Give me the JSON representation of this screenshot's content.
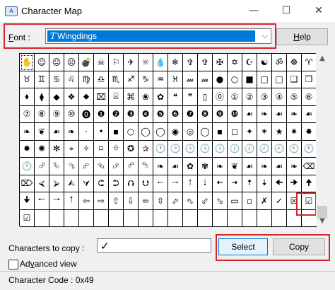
{
  "window": {
    "title": "Character Map",
    "app_icon_text": "A",
    "minimize": "—",
    "maximize": "☐",
    "close": "✕"
  },
  "font": {
    "label_prefix": "F",
    "label_rest": "ont :",
    "icon": "T",
    "selected": "Wingdings",
    "dropdown_arrow": "⌵"
  },
  "help_button": {
    "label": "Help",
    "accesskey": "H",
    "rest": "elp"
  },
  "grid": {
    "rows": [
      [
        "✋",
        "☺",
        "😐",
        "☹",
        "💣",
        "☠",
        "⚐",
        "✈",
        "☼",
        "💧",
        "❄",
        "✞",
        "✞",
        "✠",
        "✡",
        "☪",
        "☯",
        "ॐ",
        "☸",
        "♈"
      ],
      [
        "♉",
        "♊",
        "♋",
        "♌",
        "♍",
        "♎",
        "♏",
        "♐",
        "♑",
        "♒",
        "♓",
        "𝓂",
        "𝓂",
        "●",
        "○",
        "■",
        "□",
        "□",
        "❑",
        "❒"
      ],
      [
        "⬧",
        "⧫",
        "◆",
        "❖",
        "⬥",
        "⌧",
        "⍓",
        "⌘",
        "❀",
        "✿",
        "❝",
        "❞",
        "▯",
        "⓪",
        "①",
        "②",
        "③",
        "④",
        "⑤",
        "⑥"
      ],
      [
        "⑦",
        "⑧",
        "⑨",
        "⑩",
        "⓿",
        "❶",
        "❷",
        "❸",
        "❹",
        "❺",
        "❻",
        "❼",
        "❽",
        "❾",
        "❿",
        "☙",
        "❧",
        "☙",
        "❧",
        "☙"
      ],
      [
        "❧",
        "❦",
        "☙",
        "❧",
        "·",
        "•",
        "▪",
        "○",
        "◯",
        "◯",
        "◉",
        "◎",
        "◯",
        "▪",
        "◻",
        "✦",
        "✶",
        "★",
        "✷",
        "✸"
      ],
      [
        "✹",
        "✺",
        "✻",
        "⌖",
        "✧",
        "⌑",
        "⯐",
        "✪",
        "✰",
        "🕐",
        "🕑",
        "🕒",
        "🕓",
        "🕔",
        "🕕",
        "🕖",
        "🕗",
        "🕘",
        "🕙",
        "🕚"
      ],
      [
        "🕛",
        "⮰",
        "⮱",
        "⮲",
        "⮳",
        "⮴",
        "⮵",
        "⮶",
        "⮷",
        "❧",
        "☙",
        "✿",
        "✾",
        "❧",
        "❦",
        "☙",
        "❧",
        "☙",
        "❧",
        "⌫"
      ],
      [
        "⌦",
        "⮘",
        "⮚",
        "⮙",
        "⮛",
        "⮈",
        "⮊",
        "⮉",
        "⮋",
        "🠀",
        "🠂",
        "🠁",
        "🠃",
        "🠄",
        "🠆",
        "🠅",
        "🠇",
        "🠈",
        "🠊",
        "🠉"
      ],
      [
        "🠋",
        "🠐",
        "🠒",
        "🠑",
        "⇦",
        "⇨",
        "⇧",
        "⇩",
        "⬄",
        "⇳",
        "⬀",
        "⬁",
        "⬃",
        "⬂",
        "▭",
        "▫",
        "✗",
        "✓",
        "☒",
        "☑"
      ],
      [
        "☑",
        "",
        "",
        "",
        "",
        "",
        "",
        "",
        "",
        "",
        "",
        "",
        "",
        "",
        "",
        "",
        "",
        "",
        "",
        ""
      ]
    ]
  },
  "copy": {
    "label": "Characters to copy :",
    "value": "✓",
    "select_label": "Select",
    "copy_label": "Copy"
  },
  "advanced": {
    "label_prefix": "Ad",
    "accesskey": "v",
    "label_rest": "anced view"
  },
  "status": {
    "text": "Character Code : 0x49"
  },
  "colors": {
    "accent": "#0078d7",
    "highlight_border": "#d3272e"
  }
}
